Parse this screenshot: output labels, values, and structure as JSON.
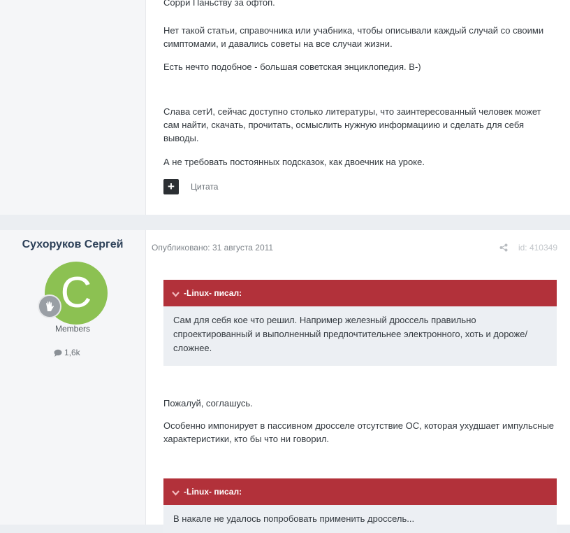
{
  "post1": {
    "paragraphs": [
      "Сорри Паньству за офтоп.",
      "Нет такой статьи, справочника или учабника, чтобы описывали каждый случай со своими симптомами, и давались советы на все случаи жизни.",
      "Есть нечто подобное - большая советская энциклопедия. В-)",
      "Слава сетИ, сейчас доступно столько литературы, что заинтересованный человек может сам найти, скачать, прочитать, осмыслить нужную информациию и сделать для себя выводы.",
      "А не требовать постоянных подсказок, как двоечник на уроке."
    ],
    "multiquote_icon": "+",
    "quote_label": "Цитата"
  },
  "post2": {
    "author": "Сухоруков Сергей",
    "avatar_letter": "C",
    "avatar_color": "#8cc152",
    "group": "Members",
    "post_count": "1,6k",
    "published": "Опубликовано: 31 августа 2011",
    "post_id": "id: 410349",
    "quote1": {
      "header": "-Linux- писал:",
      "text": "Сам для себя кое что решил. Например железный дроссель правильно спроектированный и выполненный предпочтительнее электронного, хоть и дороже/сложнее."
    },
    "paragraphs": [
      "Пожалуй, соглашусь.",
      "Особенно импонирует в пассивном дросселе отсутствие ОС, которая ухудшает импульсные характеристики, кто бы что ни говорил."
    ],
    "quote2": {
      "header": "-Linux- писал:",
      "text": "В накале не удалось попробовать применить дроссель..."
    }
  },
  "colors": {
    "quote_header": "#b2313a",
    "quote_body": "#eceff3",
    "author_name": "#2b3f57"
  }
}
